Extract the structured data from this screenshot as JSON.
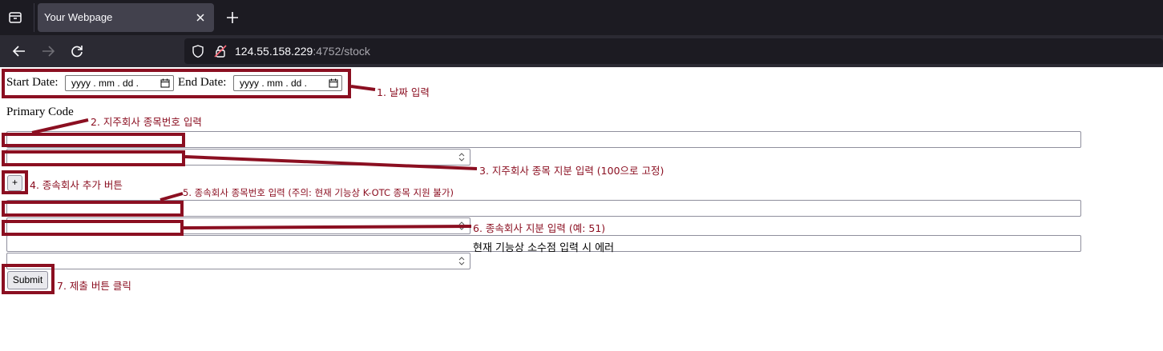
{
  "browser": {
    "tab_title": "Your Webpage",
    "url_host": "124.55.158.229",
    "url_rest": ":4752/stock"
  },
  "form": {
    "start_date_label": "Start Date:",
    "end_date_label": "End Date:",
    "date_placeholder": "yyyy .  mm .  dd .",
    "primary_code_label": "Primary Code",
    "add_button": "+",
    "submit_button": "Submit"
  },
  "annotations": {
    "a1": "1. 날짜 입력",
    "a2": "2. 지주회사 종목번호 입력",
    "a3": "3. 지주회사 종목 지분 입력 (100으로 고정)",
    "a4": "4. 종속회사 추가 버튼",
    "a5": "5. 종속회사 종목번호 입력 (주의: 현재 기능상 K-OTC 종목 지원 불가)",
    "a6": "6. 종속회사 지분 입력 (예: 51)",
    "note": "현재 기능상 소수점 입력 시 에러",
    "a7": "7. 제출 버튼 클릭"
  },
  "colors": {
    "annotation": "#8b0f21",
    "tab_bar": "#1c1b22",
    "nav_bar": "#2b2a33"
  }
}
